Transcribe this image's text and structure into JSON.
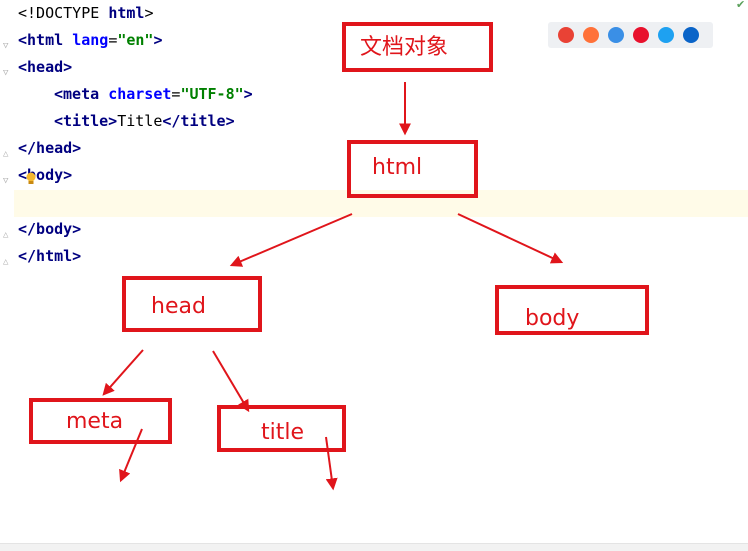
{
  "editor": {
    "lines": [
      {
        "parts": [
          {
            "t": "<!DOCTYPE ",
            "c": "txt"
          },
          {
            "t": "html",
            "c": "tag"
          },
          {
            "t": ">",
            "c": "txt"
          }
        ]
      },
      {
        "parts": [
          {
            "t": "<html ",
            "c": "tag"
          },
          {
            "t": "lang",
            "c": "attr"
          },
          {
            "t": "=",
            "c": "txt"
          },
          {
            "t": "\"en\"",
            "c": "val"
          },
          {
            "t": ">",
            "c": "tag"
          }
        ]
      },
      {
        "parts": [
          {
            "t": "<head>",
            "c": "tag"
          }
        ]
      },
      {
        "parts": [
          {
            "t": "<meta ",
            "c": "tag"
          },
          {
            "t": "charset",
            "c": "attr"
          },
          {
            "t": "=",
            "c": "txt"
          },
          {
            "t": "\"UTF-8\"",
            "c": "val"
          },
          {
            "t": ">",
            "c": "tag"
          }
        ],
        "indent": true
      },
      {
        "parts": [
          {
            "t": "<title>",
            "c": "tag"
          },
          {
            "t": "Title",
            "c": "txt"
          },
          {
            "t": "</title>",
            "c": "tag"
          }
        ],
        "indent": true
      },
      {
        "parts": [
          {
            "t": "</head>",
            "c": "tag"
          }
        ]
      },
      {
        "parts": [
          {
            "t": "<",
            "c": "tag"
          },
          {
            "t": "body>",
            "c": "tag"
          }
        ]
      },
      {
        "parts": []
      },
      {
        "parts": [
          {
            "t": "</body>",
            "c": "tag"
          }
        ]
      },
      {
        "parts": [
          {
            "t": "</html>",
            "c": "tag"
          }
        ]
      }
    ]
  },
  "browser_icons": [
    {
      "name": "chrome-icon",
      "color": "#e94235"
    },
    {
      "name": "firefox-icon",
      "color": "#ff7139"
    },
    {
      "name": "safari-icon",
      "color": "#3a8fe6"
    },
    {
      "name": "opera-icon",
      "color": "#e8112d"
    },
    {
      "name": "ie-icon",
      "color": "#1ea1f1"
    },
    {
      "name": "edge-icon",
      "color": "#0a64c8"
    }
  ],
  "diagram": {
    "stroke_color": "#e0151b",
    "nodes": {
      "document": "文档对象",
      "html": "html",
      "head": "head",
      "body": "body",
      "meta": "meta",
      "title": "title"
    }
  }
}
